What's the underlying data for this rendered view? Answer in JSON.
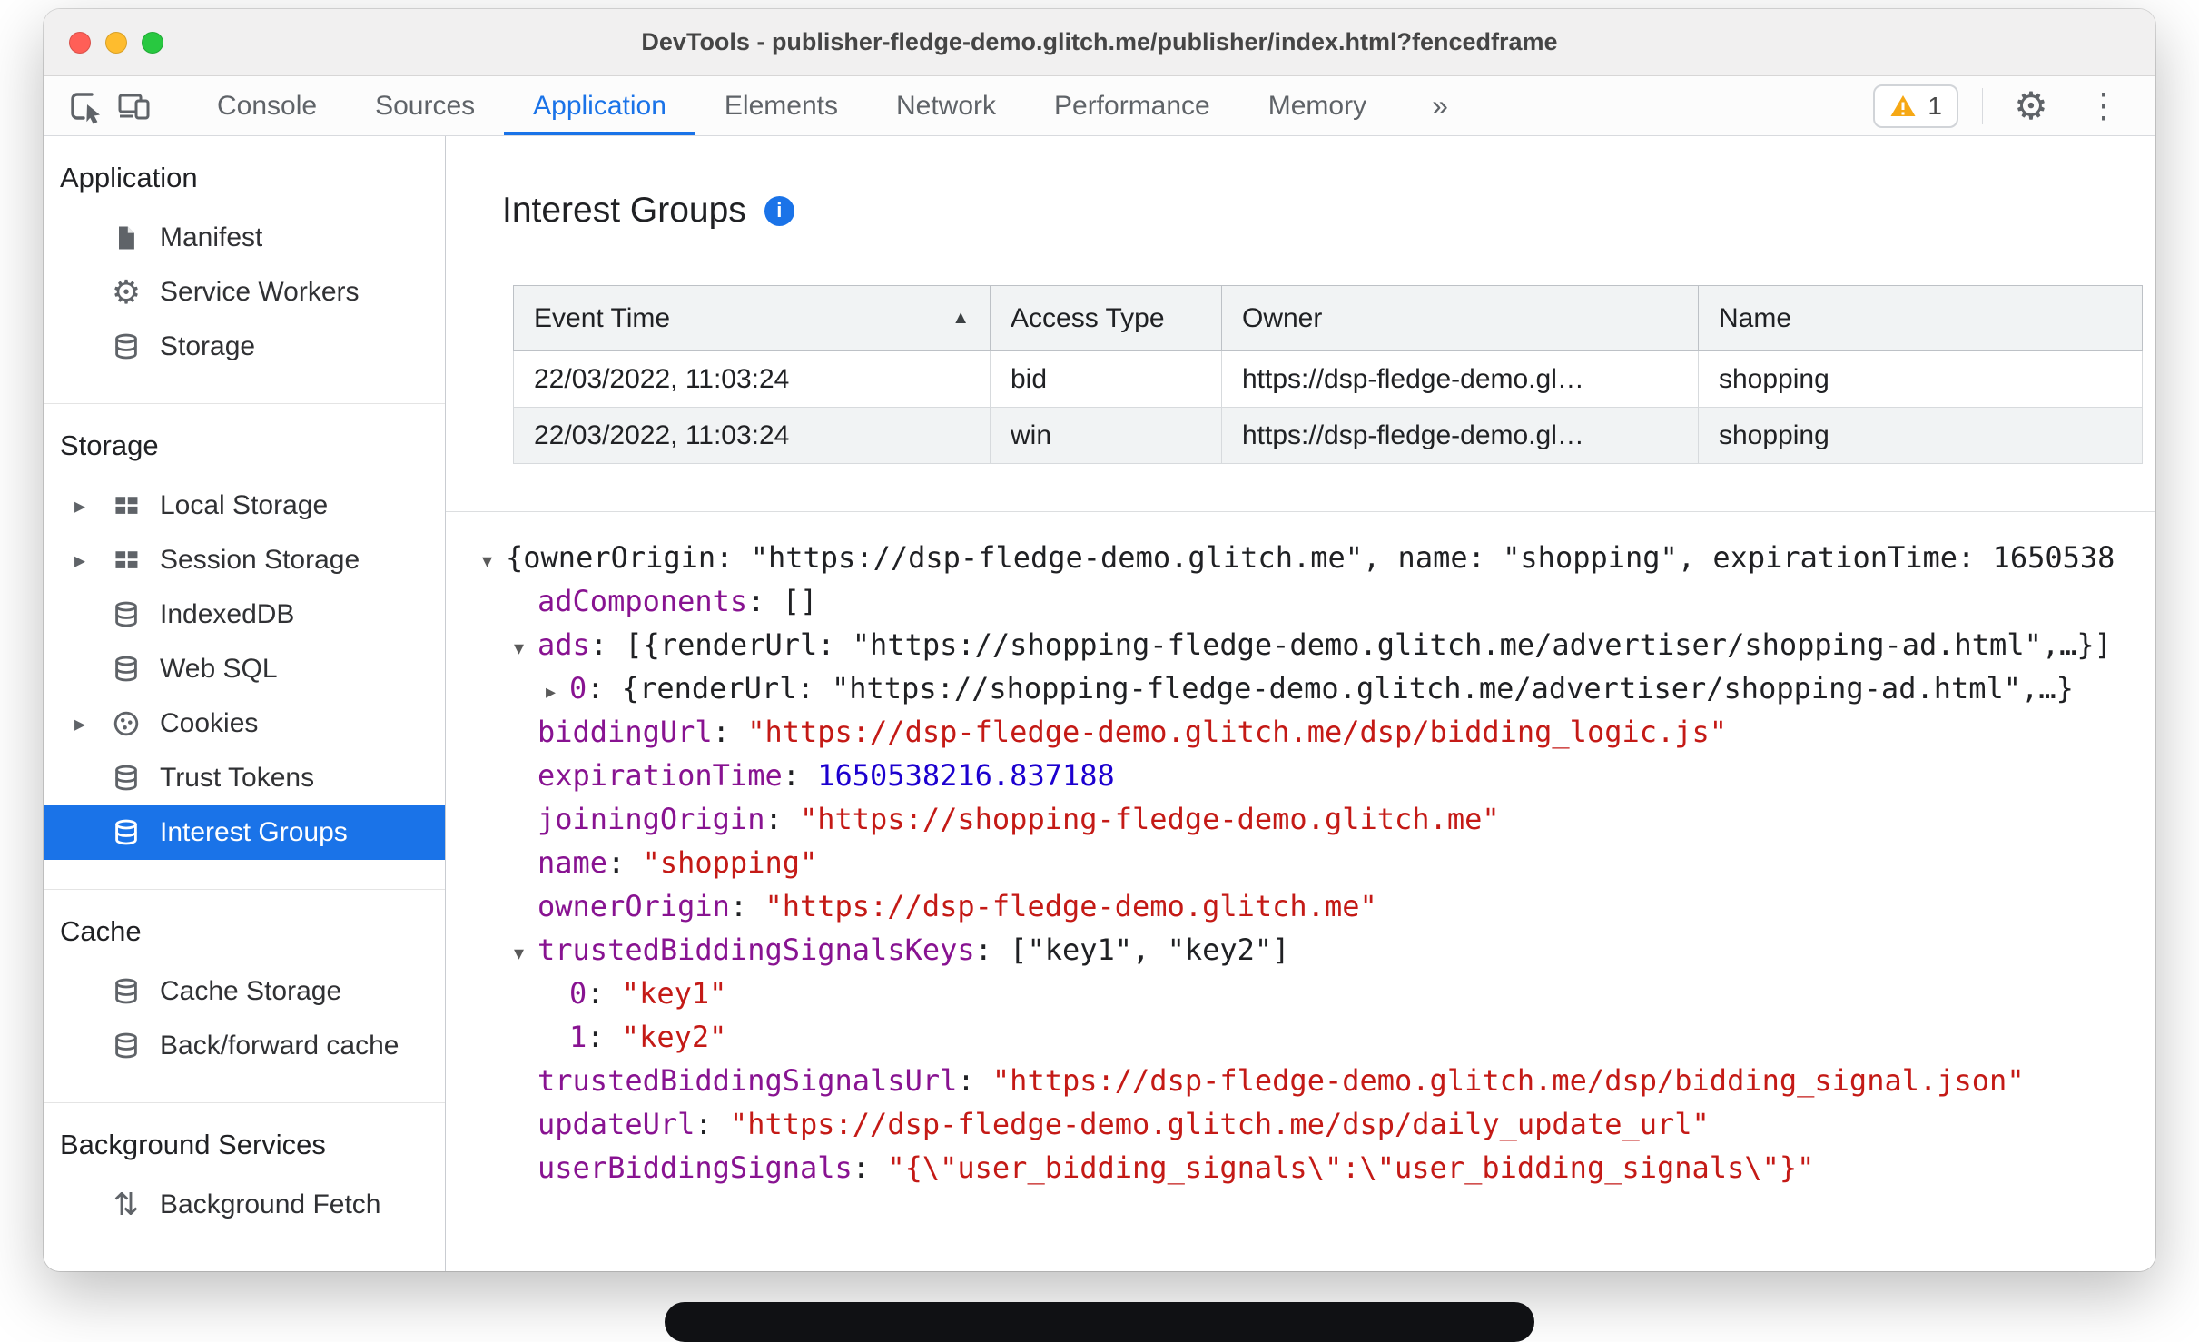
{
  "window": {
    "title": "DevTools - publisher-fledge-demo.glitch.me/publisher/index.html?fencedframe"
  },
  "toolbar": {
    "tabs": [
      {
        "label": "Console"
      },
      {
        "label": "Sources"
      },
      {
        "label": "Application"
      },
      {
        "label": "Elements"
      },
      {
        "label": "Network"
      },
      {
        "label": "Performance"
      },
      {
        "label": "Memory"
      }
    ],
    "more_tabs": "»",
    "warning_count": "1"
  },
  "sidebar": {
    "sections": [
      {
        "header": "Application",
        "items": [
          {
            "label": "Manifest"
          },
          {
            "label": "Service Workers"
          },
          {
            "label": "Storage"
          }
        ]
      },
      {
        "header": "Storage",
        "items": [
          {
            "label": "Local Storage"
          },
          {
            "label": "Session Storage"
          },
          {
            "label": "IndexedDB"
          },
          {
            "label": "Web SQL"
          },
          {
            "label": "Cookies"
          },
          {
            "label": "Trust Tokens"
          },
          {
            "label": "Interest Groups"
          }
        ]
      },
      {
        "header": "Cache",
        "items": [
          {
            "label": "Cache Storage"
          },
          {
            "label": "Back/forward cache"
          }
        ]
      },
      {
        "header": "Background Services",
        "items": [
          {
            "label": "Background Fetch"
          }
        ]
      }
    ]
  },
  "main": {
    "title": "Interest Groups",
    "table": {
      "columns": [
        "Event Time",
        "Access Type",
        "Owner",
        "Name"
      ],
      "rows": [
        [
          "22/03/2022, 11:03:24",
          "bid",
          "https://dsp-fledge-demo.gl…",
          "shopping"
        ],
        [
          "22/03/2022, 11:03:24",
          "win",
          "https://dsp-fledge-demo.gl…",
          "shopping"
        ]
      ]
    },
    "tree": {
      "colon": ": ",
      "lines": [
        {
          "preview": "{ownerOrigin: \"https://dsp-fledge-demo.glitch.me\", name: \"shopping\", expirationTime: 1650538"
        },
        {
          "key": "adComponents",
          "value": "[]"
        },
        {
          "key": "ads",
          "preview": "[{renderUrl: \"https://shopping-fledge-demo.glitch.me/advertiser/shopping-ad.html\",…}]"
        },
        {
          "key": "0",
          "preview": "{renderUrl: \"https://shopping-fledge-demo.glitch.me/advertiser/shopping-ad.html\",…}"
        },
        {
          "key": "biddingUrl",
          "value": "\"https://dsp-fledge-demo.glitch.me/dsp/bidding_logic.js\""
        },
        {
          "key": "expirationTime",
          "value": "1650538216.837188"
        },
        {
          "key": "joiningOrigin",
          "value": "\"https://shopping-fledge-demo.glitch.me\""
        },
        {
          "key": "name",
          "value": "\"shopping\""
        },
        {
          "key": "ownerOrigin",
          "value": "\"https://dsp-fledge-demo.glitch.me\""
        },
        {
          "key": "trustedBiddingSignalsKeys",
          "preview": "[\"key1\", \"key2\"]"
        },
        {
          "key": "0",
          "value": "\"key1\""
        },
        {
          "key": "1",
          "value": "\"key2\""
        },
        {
          "key": "trustedBiddingSignalsUrl",
          "value": "\"https://dsp-fledge-demo.glitch.me/dsp/bidding_signal.json\""
        },
        {
          "key": "updateUrl",
          "value": "\"https://dsp-fledge-demo.glitch.me/dsp/daily_update_url\""
        },
        {
          "key": "userBiddingSignals",
          "value": "\"{\\\"user_bidding_signals\\\":\\\"user_bidding_signals\\\"}\""
        }
      ]
    }
  }
}
